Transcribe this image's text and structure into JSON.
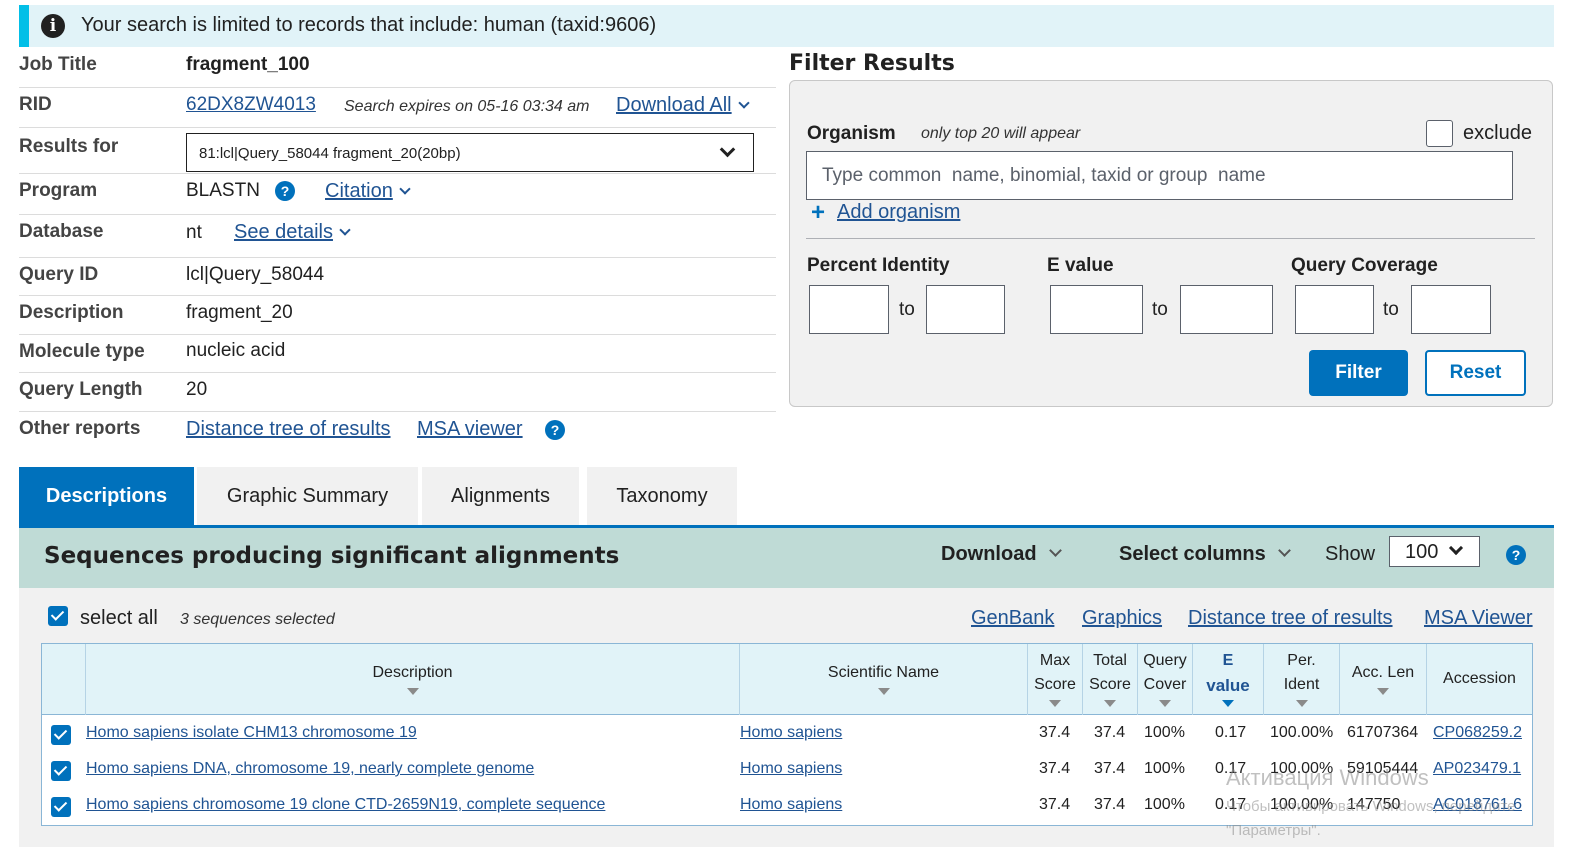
{
  "banner": {
    "text": "Your search is limited to records that include: human (taxid:9606)"
  },
  "summary": {
    "job_title_label": "Job Title",
    "job_title": "fragment_100",
    "rid_label": "RID",
    "rid": "62DX8ZW4013",
    "expires": "Search expires on 05-16 03:34 am",
    "download_all": "Download All",
    "results_for_label": "Results for",
    "results_for": "81:lcl|Query_58044 fragment_20(20bp)",
    "program_label": "Program",
    "program": "BLASTN",
    "citation": "Citation",
    "database_label": "Database",
    "database": "nt",
    "see_details": "See details",
    "query_id_label": "Query ID",
    "query_id": "lcl|Query_58044",
    "description_label": "Description",
    "description": "fragment_20",
    "molecule_type_label": "Molecule type",
    "molecule_type": "nucleic acid",
    "query_length_label": "Query Length",
    "query_length": "20",
    "other_reports_label": "Other reports",
    "distance_tree": "Distance tree of results",
    "msa_viewer": "MSA viewer"
  },
  "filter": {
    "title": "Filter Results",
    "organism_label": "Organism",
    "organism_note": "only top 20 will appear",
    "exclude_label": "exclude",
    "organism_placeholder": "Type common  name, binomial, taxid or group  name",
    "add_organism": "Add organism",
    "percent_identity_label": "Percent Identity",
    "evalue_label": "E value",
    "query_coverage_label": "Query Coverage",
    "to_label": "to",
    "filter_button": "Filter",
    "reset_button": "Reset"
  },
  "tabs": [
    {
      "label": "Descriptions",
      "active": true
    },
    {
      "label": "Graphic Summary",
      "active": false
    },
    {
      "label": "Alignments",
      "active": false
    },
    {
      "label": "Taxonomy",
      "active": false
    }
  ],
  "results": {
    "title": "Sequences producing significant alignments",
    "download": "Download",
    "select_columns": "Select columns",
    "show_label": "Show",
    "show_value": "100",
    "select_all": "select all",
    "selected_count": "3 sequences selected",
    "links": {
      "genbank": "GenBank",
      "graphics": "Graphics",
      "distance_tree": "Distance tree of results",
      "msa_viewer": "MSA Viewer"
    },
    "columns": {
      "description": "Description",
      "scientific_name": "Scientific Name",
      "max_score_1": "Max",
      "max_score_2": "Score",
      "total_score_1": "Total",
      "total_score_2": "Score",
      "query_cover_1": "Query",
      "query_cover_2": "Cover",
      "evalue_1": "E",
      "evalue_2": "value",
      "per_ident_1": "Per.",
      "per_ident_2": "Ident",
      "acc_len": "Acc. Len",
      "accession": "Accession"
    },
    "rows": [
      {
        "description": "Homo sapiens isolate CHM13 chromosome 19",
        "scientific_name": "Homo sapiens",
        "max_score": "37.4",
        "total_score": "37.4",
        "query_cover": "100%",
        "evalue": "0.17",
        "per_ident": "100.00%",
        "acc_len": "61707364",
        "accession": "CP068259.2"
      },
      {
        "description": "Homo sapiens DNA, chromosome 19, nearly complete genome",
        "scientific_name": "Homo sapiens",
        "max_score": "37.4",
        "total_score": "37.4",
        "query_cover": "100%",
        "evalue": "0.17",
        "per_ident": "100.00%",
        "acc_len": "59105444",
        "accession": "AP023479.1"
      },
      {
        "description": "Homo sapiens chromosome 19 clone CTD-2659N19, complete sequence",
        "scientific_name": "Homo sapiens",
        "max_score": "37.4",
        "total_score": "37.4",
        "query_cover": "100%",
        "evalue": "0.17",
        "per_ident": "100.00%",
        "acc_len": "147750",
        "accession": "AC018761.6"
      }
    ]
  },
  "watermark": {
    "line1": "Активация Windows",
    "line2": "Чтобы активировать Windows, перейдите",
    "line3": "\"Параметры\"."
  },
  "colors": {
    "primary": "#0071bc",
    "link": "#205493",
    "banner_bg": "#e1f3f8",
    "banner_accent": "#02bfe7",
    "results_head_bg": "#bfdbd6"
  }
}
